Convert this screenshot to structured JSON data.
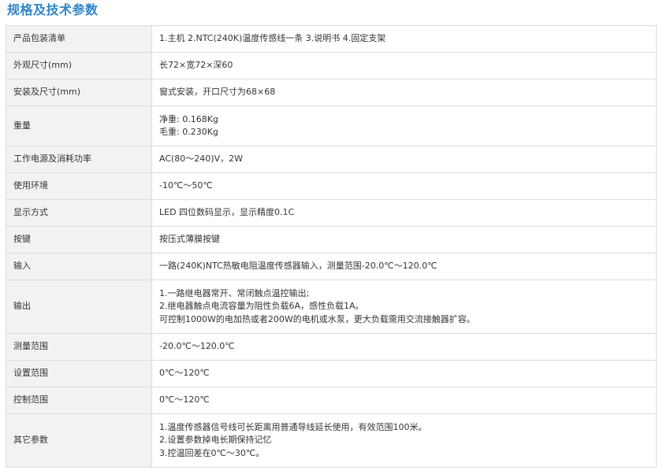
{
  "page": {
    "title": "规格及技术参数"
  },
  "spec_table": {
    "rows": [
      {
        "label": "产品包装清单",
        "lines": [
          "1.主机  2.NTC(240K)温度传感线一条  3.说明书  4.固定支架"
        ]
      },
      {
        "label": "外观尺寸(mm)",
        "lines": [
          "长72×宽72×深60"
        ]
      },
      {
        "label": "安装及尺寸(mm)",
        "lines": [
          "窗式安装，开口尺寸为68×68"
        ]
      },
      {
        "label": "重量",
        "lines": [
          "净重: 0.168Kg",
          "毛重: 0.230Kg"
        ]
      },
      {
        "label": "工作电源及消耗功率",
        "lines": [
          "AC(80～240)V，2W"
        ]
      },
      {
        "label": "使用环境",
        "lines": [
          "-10℃～50℃"
        ]
      },
      {
        "label": "显示方式",
        "lines": [
          "LED 四位数码显示，显示精度0.1C"
        ]
      },
      {
        "label": "按键",
        "lines": [
          "按压式薄膜按键"
        ]
      },
      {
        "label": "输入",
        "lines": [
          "一路(240K)NTC热敏电阻温度传感器输入，测量范围-20.0℃～120.0℃"
        ]
      },
      {
        "label": "输出",
        "lines": [
          "1.一路继电器常开、常闭触点温控输出;",
          "2.继电器触点电流容量为阻性负载6A，感性负载1A。",
          "可控制1000W的电加热或者200W的电机或水泵，更大负载需用交流接触器扩容。"
        ]
      },
      {
        "label": "测量范围",
        "lines": [
          "-20.0℃～120.0℃"
        ]
      },
      {
        "label": "设置范围",
        "lines": [
          "0℃～120℃"
        ]
      },
      {
        "label": "控制范围",
        "lines": [
          "0℃～120℃"
        ]
      },
      {
        "label": "其它参数",
        "lines": [
          "1.温度传感器信号线可长距离用普通导线延长使用，有效范围100米。",
          "2.设置参数掉电长期保持记忆",
          "3.控温回差在0℃～30℃。"
        ]
      }
    ]
  }
}
